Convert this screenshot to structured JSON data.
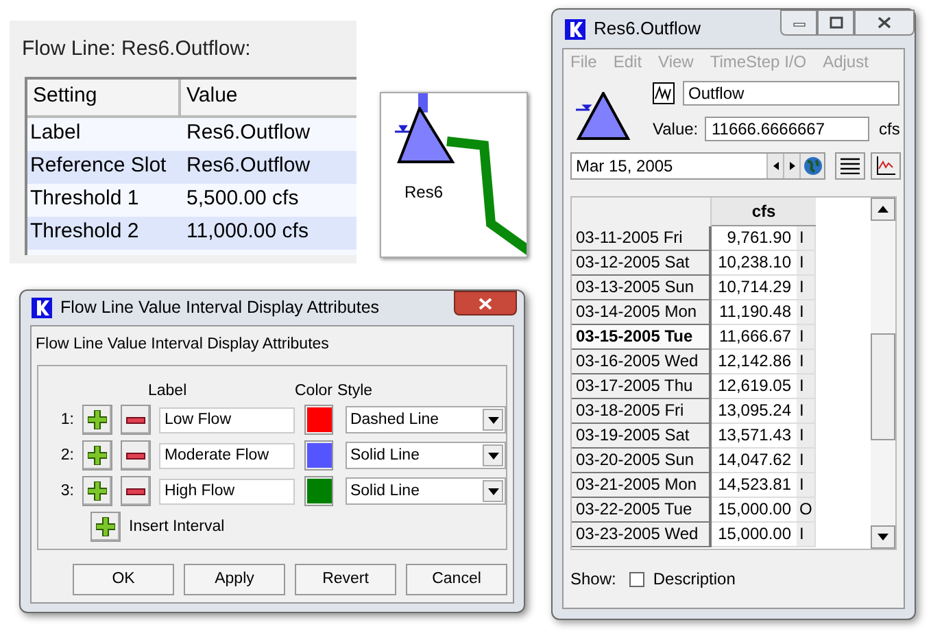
{
  "settings_panel": {
    "title": "Flow Line: Res6.Outflow:",
    "columns": [
      "Setting",
      "Value"
    ],
    "rows": [
      {
        "setting": "Label",
        "value": "Res6.Outflow"
      },
      {
        "setting": "Reference Slot",
        "value": "Res6.Outflow"
      },
      {
        "setting": "Threshold 1",
        "value": "5,500.00 cfs"
      },
      {
        "setting": "Threshold 2",
        "value": "11,000.00 cfs"
      }
    ]
  },
  "diagram": {
    "label": "Res6"
  },
  "slot_window": {
    "title": "Res6.Outflow",
    "menu": [
      {
        "label": "File",
        "disabled": true
      },
      {
        "label": "Edit",
        "disabled": true
      },
      {
        "label": "View",
        "disabled": true
      },
      {
        "label": "TimeStep I/O",
        "disabled": true
      },
      {
        "label": "Adjust",
        "disabled": true
      }
    ],
    "slot_name": "Outflow",
    "value_label": "Value:",
    "value": "11666.6666667",
    "unit": "cfs",
    "date": "Mar 15, 2005",
    "column_header": "cfs",
    "rows": [
      {
        "date": "03-11-2005 Fri",
        "value": "9,761.90",
        "flag": "I",
        "selected": false
      },
      {
        "date": "03-12-2005 Sat",
        "value": "10,238.10",
        "flag": "I",
        "selected": false
      },
      {
        "date": "03-13-2005 Sun",
        "value": "10,714.29",
        "flag": "I",
        "selected": false
      },
      {
        "date": "03-14-2005 Mon",
        "value": "11,190.48",
        "flag": "I",
        "selected": false
      },
      {
        "date": "03-15-2005 Tue",
        "value": "11,666.67",
        "flag": "I",
        "selected": true
      },
      {
        "date": "03-16-2005 Wed",
        "value": "12,142.86",
        "flag": "I",
        "selected": false
      },
      {
        "date": "03-17-2005 Thu",
        "value": "12,619.05",
        "flag": "I",
        "selected": false
      },
      {
        "date": "03-18-2005 Fri",
        "value": "13,095.24",
        "flag": "I",
        "selected": false
      },
      {
        "date": "03-19-2005 Sat",
        "value": "13,571.43",
        "flag": "I",
        "selected": false
      },
      {
        "date": "03-20-2005 Sun",
        "value": "14,047.62",
        "flag": "I",
        "selected": false
      },
      {
        "date": "03-21-2005 Mon",
        "value": "14,523.81",
        "flag": "I",
        "selected": false
      },
      {
        "date": "03-22-2005 Tue",
        "value": "15,000.00",
        "flag": "O",
        "selected": false
      },
      {
        "date": "03-23-2005 Wed",
        "value": "15,000.00",
        "flag": "I",
        "selected": false
      }
    ],
    "show_label": "Show:",
    "description": {
      "label": "Description",
      "checked": false
    }
  },
  "dialog": {
    "title": "Flow Line Value Interval Display Attributes",
    "heading": "Flow Line Value Interval Display Attributes",
    "headers": [
      "Label",
      "Color",
      "Style"
    ],
    "intervals": [
      {
        "index": "1:",
        "label": "Low Flow",
        "color": "#ff0000",
        "style": "Dashed Line"
      },
      {
        "index": "2:",
        "label": "Moderate Flow",
        "color": "#5555ff",
        "style": "Solid Line"
      },
      {
        "index": "3:",
        "label": "High Flow",
        "color": "#008000",
        "style": "Solid Line"
      }
    ],
    "insert_label": "Insert Interval",
    "buttons": [
      "OK",
      "Apply",
      "Revert",
      "Cancel"
    ]
  }
}
